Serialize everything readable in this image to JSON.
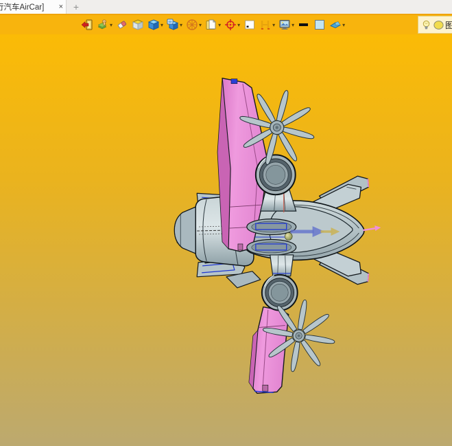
{
  "tab_bar": {
    "active_tab": {
      "title": "行汽车AirCar]",
      "close_label": "×"
    },
    "new_tab_label": "+"
  },
  "toolbar": {
    "icons": [
      {
        "name": "exit-icon",
        "dropdown": false
      },
      {
        "name": "pick-layers-icon",
        "dropdown": true
      },
      {
        "name": "eraser-icon",
        "dropdown": false
      },
      {
        "name": "sketch-solid-icon",
        "dropdown": false
      },
      {
        "name": "cube-icon",
        "dropdown": true
      },
      {
        "name": "cube-display-icon",
        "dropdown": true
      },
      {
        "name": "wheel-icon",
        "dropdown": true
      },
      {
        "name": "document-icon",
        "dropdown": true
      },
      {
        "name": "origin-target-icon",
        "dropdown": true
      },
      {
        "name": "frame-icon",
        "dropdown": false
      },
      {
        "name": "clamp-icon",
        "dropdown": true
      },
      {
        "name": "render-monitor-icon",
        "dropdown": true
      },
      {
        "name": "line-width-icon",
        "dropdown": false
      },
      {
        "name": "color-swatch-icon",
        "dropdown": false
      },
      {
        "name": "material-icon",
        "dropdown": true
      },
      {
        "name": "bulb-icon",
        "dropdown": false
      },
      {
        "name": "layer-circle-icon",
        "dropdown": false
      }
    ],
    "layer_label": "图层"
  },
  "canvas": {
    "content": "3D CAD model of flying car (AirCar), top view",
    "colors": {
      "toolbar_bg": "#f8b40d",
      "canvas_top": "#fbbb06",
      "canvas_bottom": "#bca96f",
      "wing_pink": "#e78ad3",
      "body_gray": "#b9c6ca",
      "edge_blue": "#2038d0",
      "outline": "#14191d",
      "highlight_bg": "#fdf3cf"
    }
  }
}
